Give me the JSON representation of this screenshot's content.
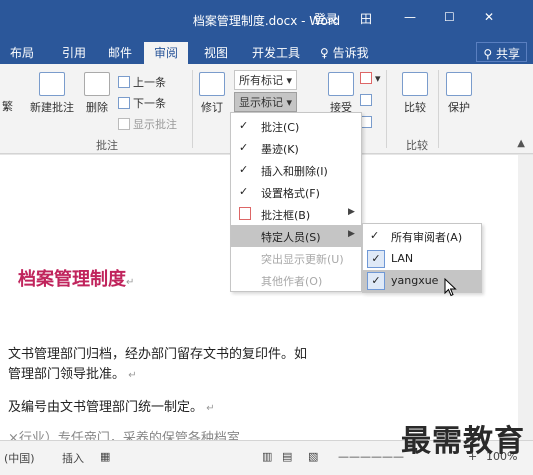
{
  "window": {
    "title": "档案管理制度.docx - Word",
    "login": "登录",
    "controls": [
      "田",
      "—",
      "☐",
      "✕"
    ]
  },
  "tabs": [
    "布局",
    "引用",
    "邮件",
    "审阅",
    "视图",
    "开发工具"
  ],
  "tell_me": "告诉我",
  "share": "共享",
  "ribbon": {
    "partial_left": "繁",
    "new_comment": "新建批注",
    "delete": "删除",
    "previous": "上一条",
    "next": "下一条",
    "show_comments": "显示批注",
    "comments_group": "批注",
    "track": "修订",
    "all_markup": "所有标记",
    "show_markup": "显示标记",
    "accept": "接受",
    "compare": "比较",
    "compare_group": "比较",
    "protect": "保护"
  },
  "show_markup_menu": {
    "header": "显示标记",
    "items": [
      {
        "label": "批注(C)",
        "checked": true,
        "submenu": false,
        "disabled": false
      },
      {
        "label": "墨迹(K)",
        "checked": true,
        "submenu": false,
        "disabled": false
      },
      {
        "label": "插入和删除(I)",
        "checked": true,
        "submenu": false,
        "disabled": false
      },
      {
        "label": "设置格式(F)",
        "checked": true,
        "submenu": false,
        "disabled": false
      },
      {
        "label": "批注框(B)",
        "checked": false,
        "submenu": true,
        "disabled": false
      },
      {
        "label": "特定人员(S)",
        "checked": false,
        "submenu": true,
        "disabled": false
      },
      {
        "label": "突出显示更新(U)",
        "checked": false,
        "submenu": false,
        "disabled": true
      },
      {
        "label": "其他作者(O)",
        "checked": false,
        "submenu": false,
        "disabled": true
      }
    ]
  },
  "reviewers_menu": {
    "items": [
      {
        "label": "所有审阅者(A)",
        "checked": true
      },
      {
        "label": "LAN",
        "checked": true
      },
      {
        "label": "yangxue",
        "checked": true
      }
    ]
  },
  "document": {
    "title": "档案管理制度",
    "lines": [
      "文书管理部门归档，经办部门留存文书的复印件。如",
      "管理部门领导批准。",
      "及编号由文书管理部门统一制定。",
      "×行业）专任帝门，采养的保管各种档室"
    ]
  },
  "status": {
    "language": "(中国)",
    "insert": "插入",
    "zoom": "100%"
  },
  "watermark": "最需教育",
  "colors": {
    "title_bar": "#2b579a",
    "doc_title": "#c0245c",
    "menu_highlight": "#c5c5c5"
  }
}
